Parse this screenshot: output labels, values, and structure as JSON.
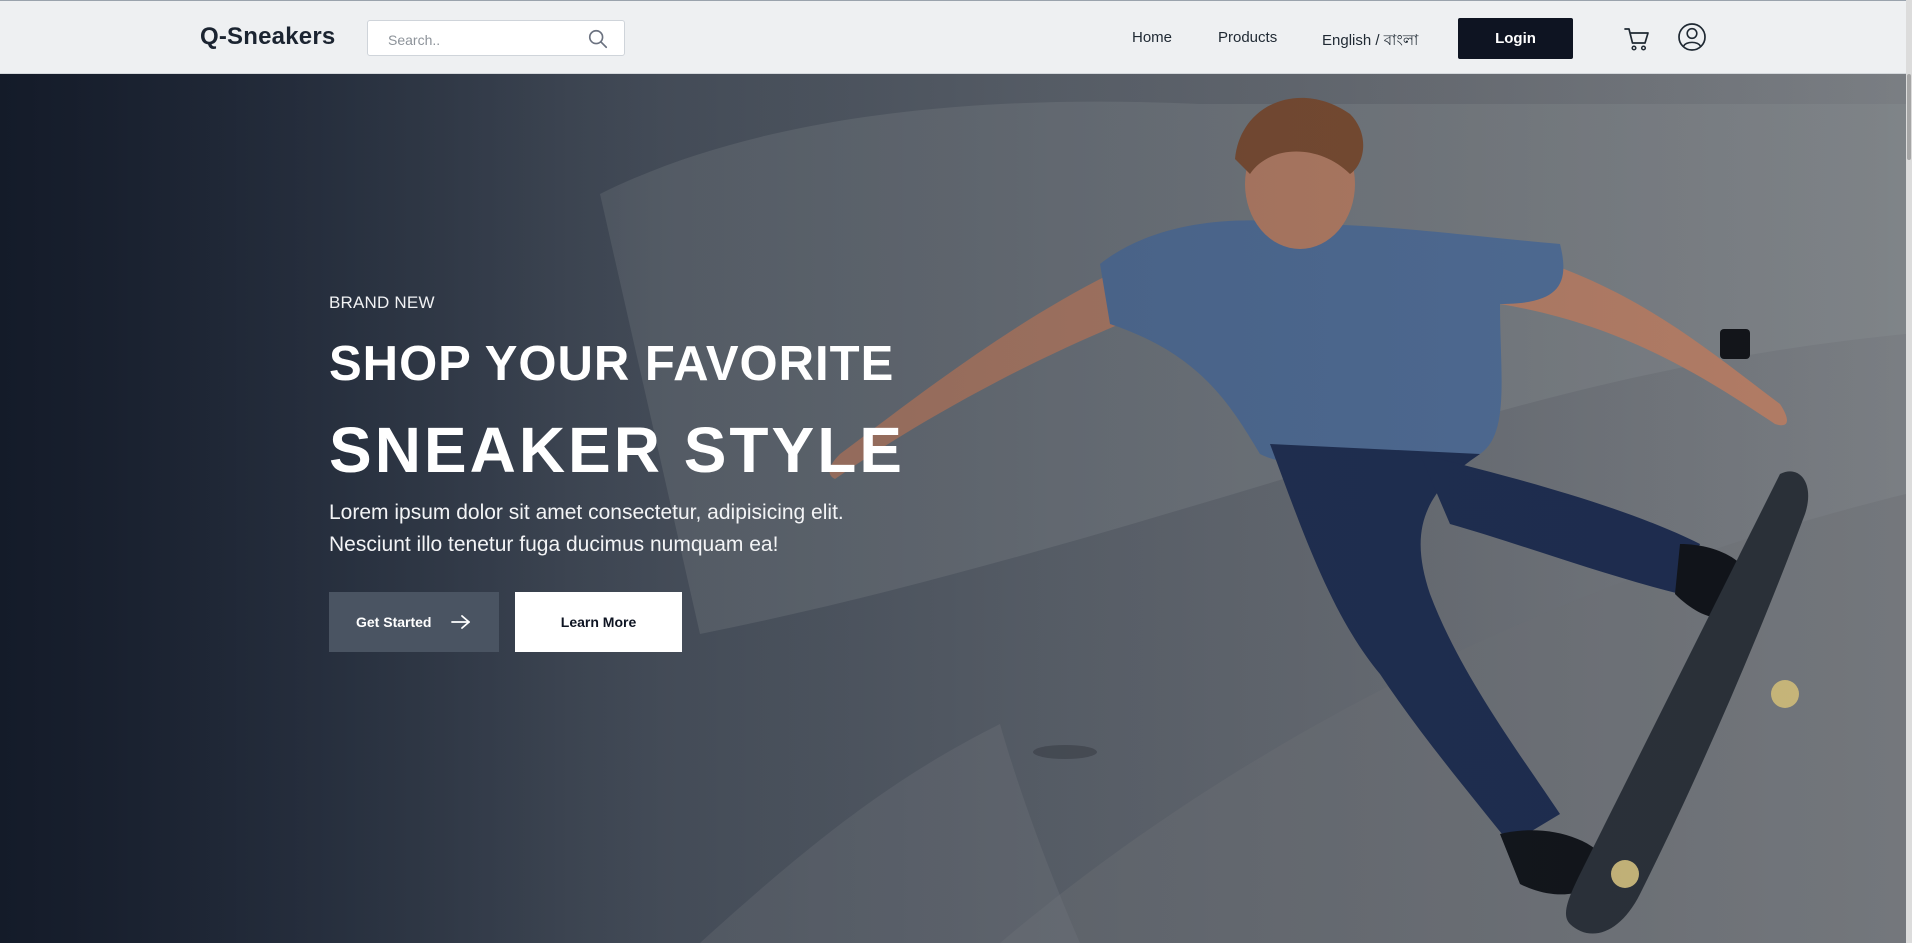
{
  "header": {
    "brand": "Q-Sneakers",
    "search": {
      "placeholder": "Search..",
      "value": "",
      "icon": "search-icon"
    },
    "nav": [
      {
        "label": "Home"
      },
      {
        "label": "Products"
      },
      {
        "label": "English / বাংলা"
      }
    ],
    "login_label": "Login",
    "cart_icon": "cart-icon",
    "account_icon": "user-circle-icon"
  },
  "hero": {
    "eyebrow": "BRAND NEW",
    "headline_line1": "SHOP YOUR FAVORITE",
    "headline_line2": "SNEAKER STYLE",
    "blurb_line1": "Lorem ipsum dolor sit amet consectetur, adipisicing elit.",
    "blurb_line2": "Nesciunt illo tenetur fuga ducimus numquam ea!",
    "primary_button": {
      "label": "Get Started",
      "icon": "arrow-right-icon"
    },
    "secondary_button": {
      "label": "Learn More"
    },
    "background_image": "skateboarder-photo"
  },
  "colors": {
    "brand_text": "#1b2431",
    "login_bg": "#0e1422",
    "primary_button_bg": "#4a5462",
    "hero_overlay": "#141b29"
  }
}
